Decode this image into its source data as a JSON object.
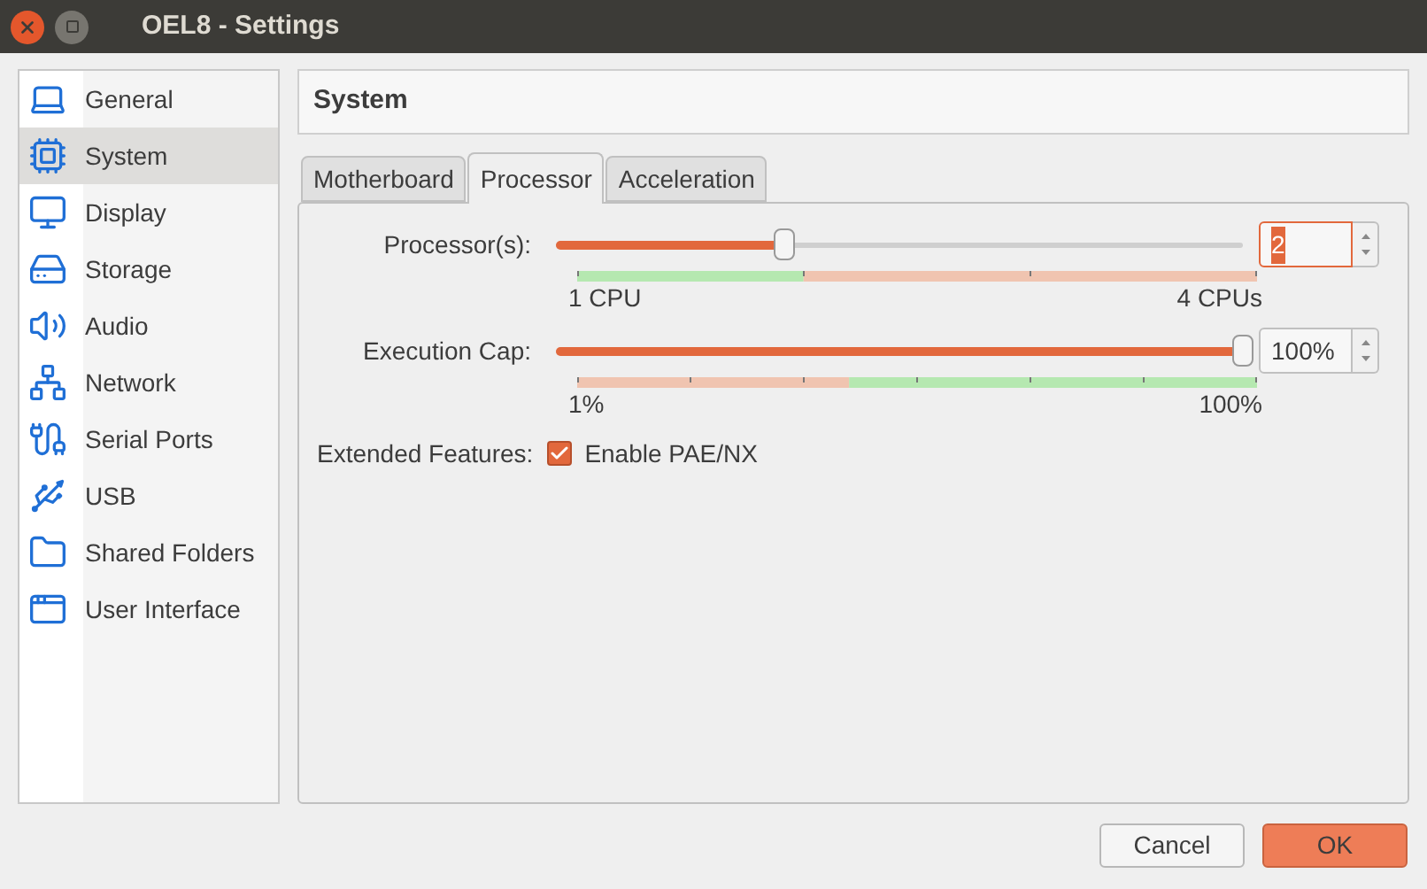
{
  "window": {
    "title": "OEL8 - Settings"
  },
  "sidebar": {
    "items": [
      {
        "label": "General",
        "selected": false
      },
      {
        "label": "System",
        "selected": true
      },
      {
        "label": "Display",
        "selected": false
      },
      {
        "label": "Storage",
        "selected": false
      },
      {
        "label": "Audio",
        "selected": false
      },
      {
        "label": "Network",
        "selected": false
      },
      {
        "label": "Serial Ports",
        "selected": false
      },
      {
        "label": "USB",
        "selected": false
      },
      {
        "label": "Shared Folders",
        "selected": false
      },
      {
        "label": "User Interface",
        "selected": false
      }
    ]
  },
  "page_title": "System",
  "tabs": [
    {
      "label": "Motherboard",
      "selected": false
    },
    {
      "label": "Processor",
      "selected": true
    },
    {
      "label": "Acceleration",
      "selected": false
    }
  ],
  "sliders": [
    {
      "label": "Processor(s):",
      "level": 0.333,
      "value": "2",
      "focused": true,
      "min_label": "1 CPU",
      "max_label": "4 CPUs"
    },
    {
      "label": "Execution Cap:",
      "level": 1,
      "value": "100%",
      "focused": false,
      "min_label": "1%",
      "max_label": "100%"
    }
  ],
  "extended_features": {
    "label": "Extended Features:",
    "checkbox": {
      "label": "Enable PAE/NX",
      "checked": true
    }
  },
  "buttons": [
    {
      "label": "Cancel",
      "kind": "secondary"
    },
    {
      "label": "OK",
      "kind": "primary"
    }
  ]
}
